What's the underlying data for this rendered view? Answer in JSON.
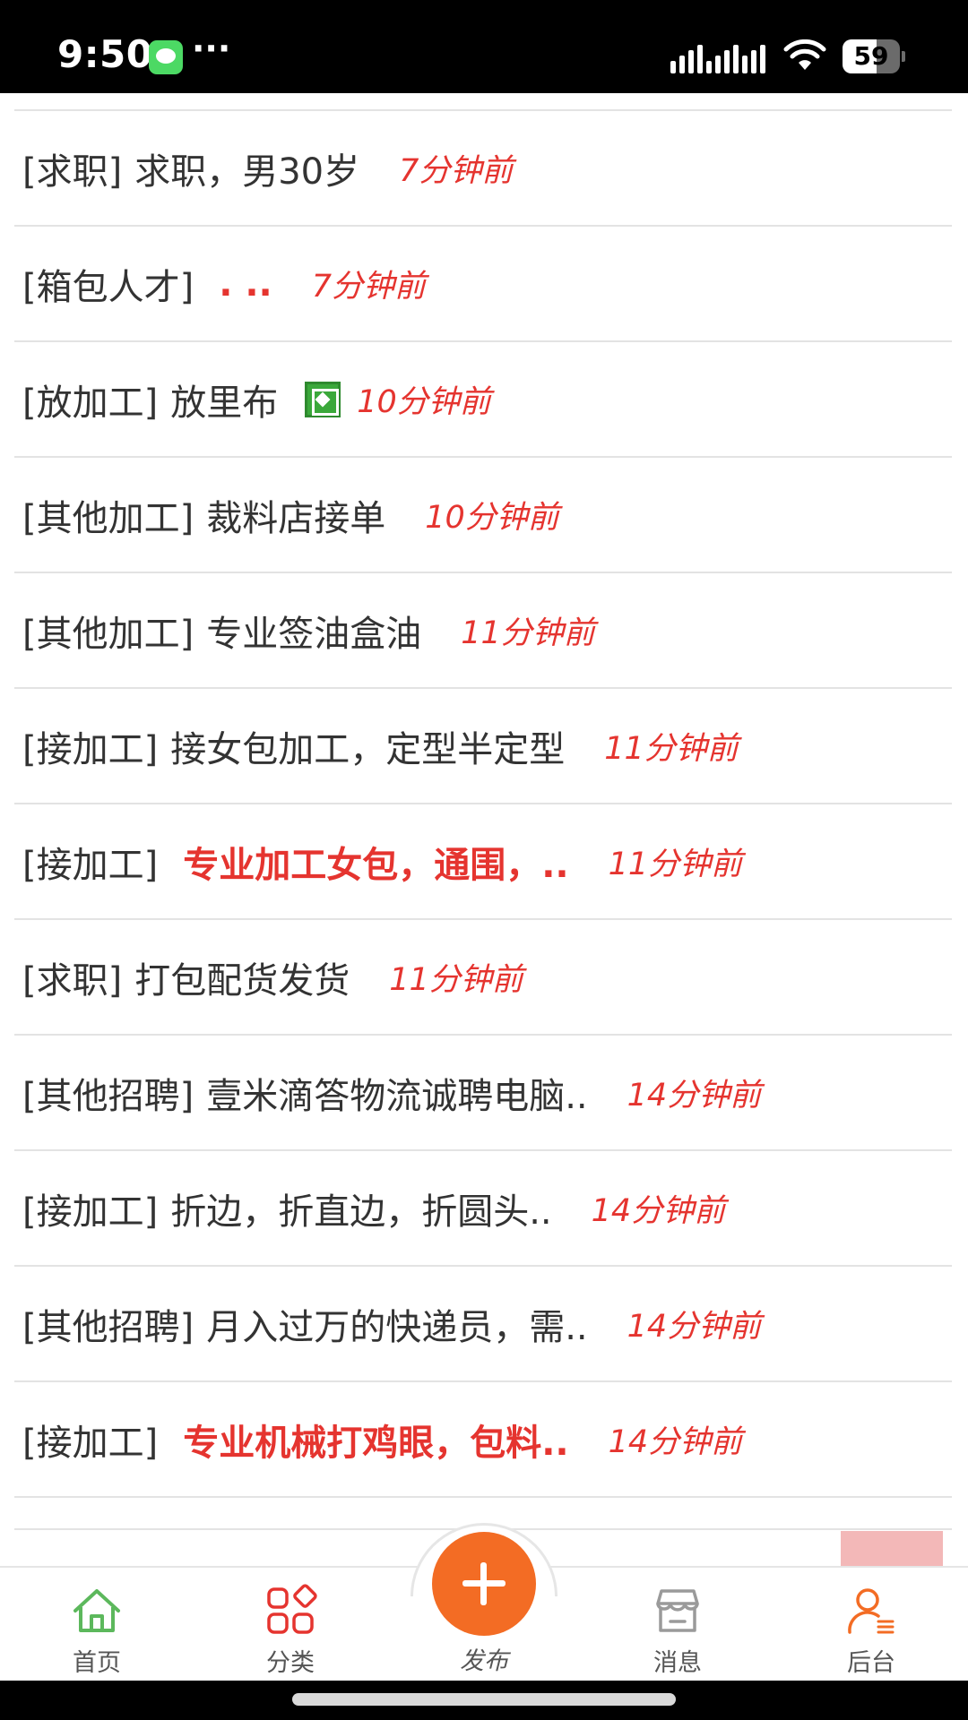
{
  "status_bar": {
    "time": "9:50",
    "dots": "···",
    "battery_percent": "59",
    "battery_level": 0.59
  },
  "listings": [
    {
      "category": "[求职]",
      "title": "求职，男30岁",
      "time": "7分钟前",
      "hot": false,
      "has_image": false
    },
    {
      "category": "[箱包人才]",
      "title": ". ..",
      "time": "7分钟前",
      "hot": true,
      "has_image": false
    },
    {
      "category": "[放加工]",
      "title": "放里布",
      "time": "10分钟前",
      "hot": false,
      "has_image": true
    },
    {
      "category": "[其他加工]",
      "title": "裁料店接单",
      "time": "10分钟前",
      "hot": false,
      "has_image": false
    },
    {
      "category": "[其他加工]",
      "title": "专业签油盒油",
      "time": "11分钟前",
      "hot": false,
      "has_image": false
    },
    {
      "category": "[接加工]",
      "title": "接女包加工，定型半定型",
      "time": "11分钟前",
      "hot": false,
      "has_image": false
    },
    {
      "category": "[接加工]",
      "title": "专业加工女包，通围，..",
      "time": "11分钟前",
      "hot": true,
      "has_image": false
    },
    {
      "category": "[求职]",
      "title": "打包配货发货",
      "time": "11分钟前",
      "hot": false,
      "has_image": false
    },
    {
      "category": "[其他招聘]",
      "title": "壹米滴答物流诚聘电脑..",
      "time": "14分钟前",
      "hot": false,
      "has_image": false
    },
    {
      "category": "[接加工]",
      "title": "折边，折直边，折圆头..",
      "time": "14分钟前",
      "hot": false,
      "has_image": false
    },
    {
      "category": "[其他招聘]",
      "title": "月入过万的快递员，需..",
      "time": "14分钟前",
      "hot": false,
      "has_image": false
    },
    {
      "category": "[接加工]",
      "title": "专业机械打鸡眼，包料..",
      "time": "14分钟前",
      "hot": true,
      "has_image": false
    }
  ],
  "tab_bar": {
    "home": {
      "label": "首页",
      "icon": "home-icon",
      "color": "#5cb85c"
    },
    "category": {
      "label": "分类",
      "icon": "grid-icon",
      "color": "#e5342f"
    },
    "publish": {
      "label": "发布",
      "icon": "plus-icon",
      "color": "#f36c24"
    },
    "messages": {
      "label": "消息",
      "icon": "store-icon",
      "color": "#9a9a9a"
    },
    "backend": {
      "label": "后台",
      "icon": "user-list-icon",
      "color": "#f36c24"
    }
  },
  "colors": {
    "accent_red": "#e5342f",
    "accent_orange": "#f36c24",
    "divider": "#e3e3e3"
  }
}
